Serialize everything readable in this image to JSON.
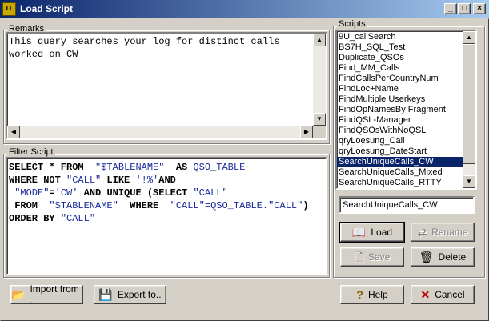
{
  "window": {
    "title": "Load Script",
    "icon": "TL",
    "buttons": {
      "minimize": "_",
      "maximize": "□",
      "close": "×"
    }
  },
  "remarks": {
    "label": "Remarks",
    "text": "This query searches your log for distinct calls worked on CW"
  },
  "filter": {
    "label": "Filter Script",
    "lines": [
      [
        {
          "t": "SELECT * FROM  ",
          "c": "kw"
        },
        {
          "t": "\"$TABLENAME\"",
          "c": "str"
        },
        {
          "t": "  AS ",
          "c": "kw"
        },
        {
          "t": "QSO_TABLE",
          "c": "id"
        }
      ],
      [
        {
          "t": "WHERE NOT ",
          "c": "kw"
        },
        {
          "t": "\"CALL\"",
          "c": "str"
        },
        {
          "t": " LIKE ",
          "c": "kw"
        },
        {
          "t": "'!%'",
          "c": "str"
        },
        {
          "t": "AND",
          "c": "kw"
        }
      ],
      [
        {
          "t": " ",
          "c": "kw"
        },
        {
          "t": "\"MODE\"",
          "c": "str"
        },
        {
          "t": "=",
          "c": "kw"
        },
        {
          "t": "'CW'",
          "c": "str"
        },
        {
          "t": " AND UNIQUE (SELECT ",
          "c": "kw"
        },
        {
          "t": "\"CALL\"",
          "c": "str"
        }
      ],
      [
        {
          "t": " FROM  ",
          "c": "kw"
        },
        {
          "t": "\"$TABLENAME\"",
          "c": "str"
        },
        {
          "t": "  WHERE  ",
          "c": "kw"
        },
        {
          "t": "\"CALL\"",
          "c": "str"
        },
        {
          "t": "=QSO_TABLE.",
          "c": "id"
        },
        {
          "t": "\"CALL\"",
          "c": "str"
        },
        {
          "t": ")",
          "c": "kw"
        }
      ],
      [
        {
          "t": "ORDER BY ",
          "c": "kw"
        },
        {
          "t": "\"CALL\"",
          "c": "str"
        }
      ]
    ]
  },
  "scripts": {
    "label": "Scripts",
    "items": [
      "9U_callSearch",
      "BS7H_SQL_Test",
      "Duplicate_QSOs",
      "Find_MM_Calls",
      "FindCallsPerCountryNum",
      "FindLoc+Name",
      "FindMultiple Userkeys",
      "FindOpNamesBy Fragment",
      "FindQSL-Manager",
      "FindQSOsWithNoQSL",
      "qryLoesung_Call",
      "qryLoesung_DateStart",
      "SearchUniqueCalls_CW",
      "SearchUniqueCalls_Mixed",
      "SearchUniqueCalls_RTTY"
    ],
    "selected_index": 12,
    "name_value": "SearchUniqueCalls_CW"
  },
  "buttons": {
    "load": "Load",
    "rename": "Rename",
    "save": "Save",
    "delete": "Delete",
    "import": "Import from ..",
    "export": "Export to..",
    "help": "Help",
    "cancel": "Cancel"
  }
}
